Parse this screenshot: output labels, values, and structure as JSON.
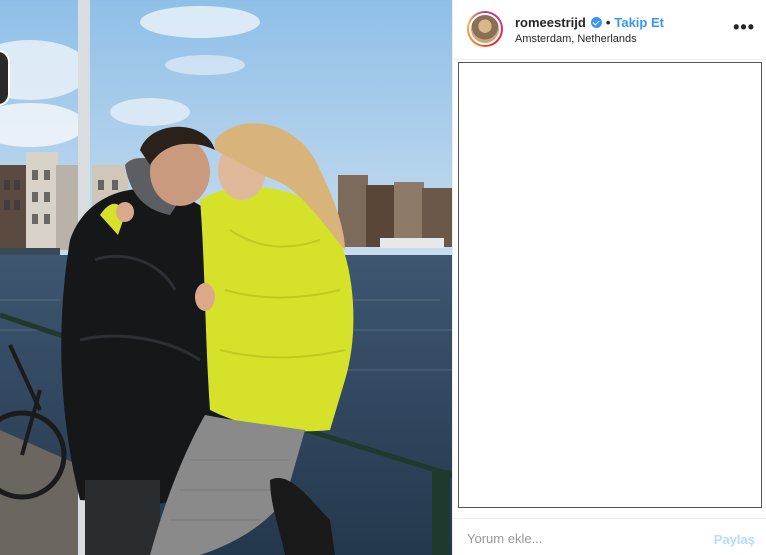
{
  "post": {
    "username": "romeestrijd",
    "separator": "•",
    "follow_label": "Takip Et",
    "location": "Amsterdam, Netherlands",
    "more_icon": "more-options-icon",
    "more_glyph": "•••"
  },
  "comment": {
    "placeholder": "Yorum ekle...",
    "share_label": "Paylaş"
  },
  "colors": {
    "accent": "#3897f0",
    "share_disabled": "#b3dbff",
    "coat_yellow": "#d6e22a"
  }
}
